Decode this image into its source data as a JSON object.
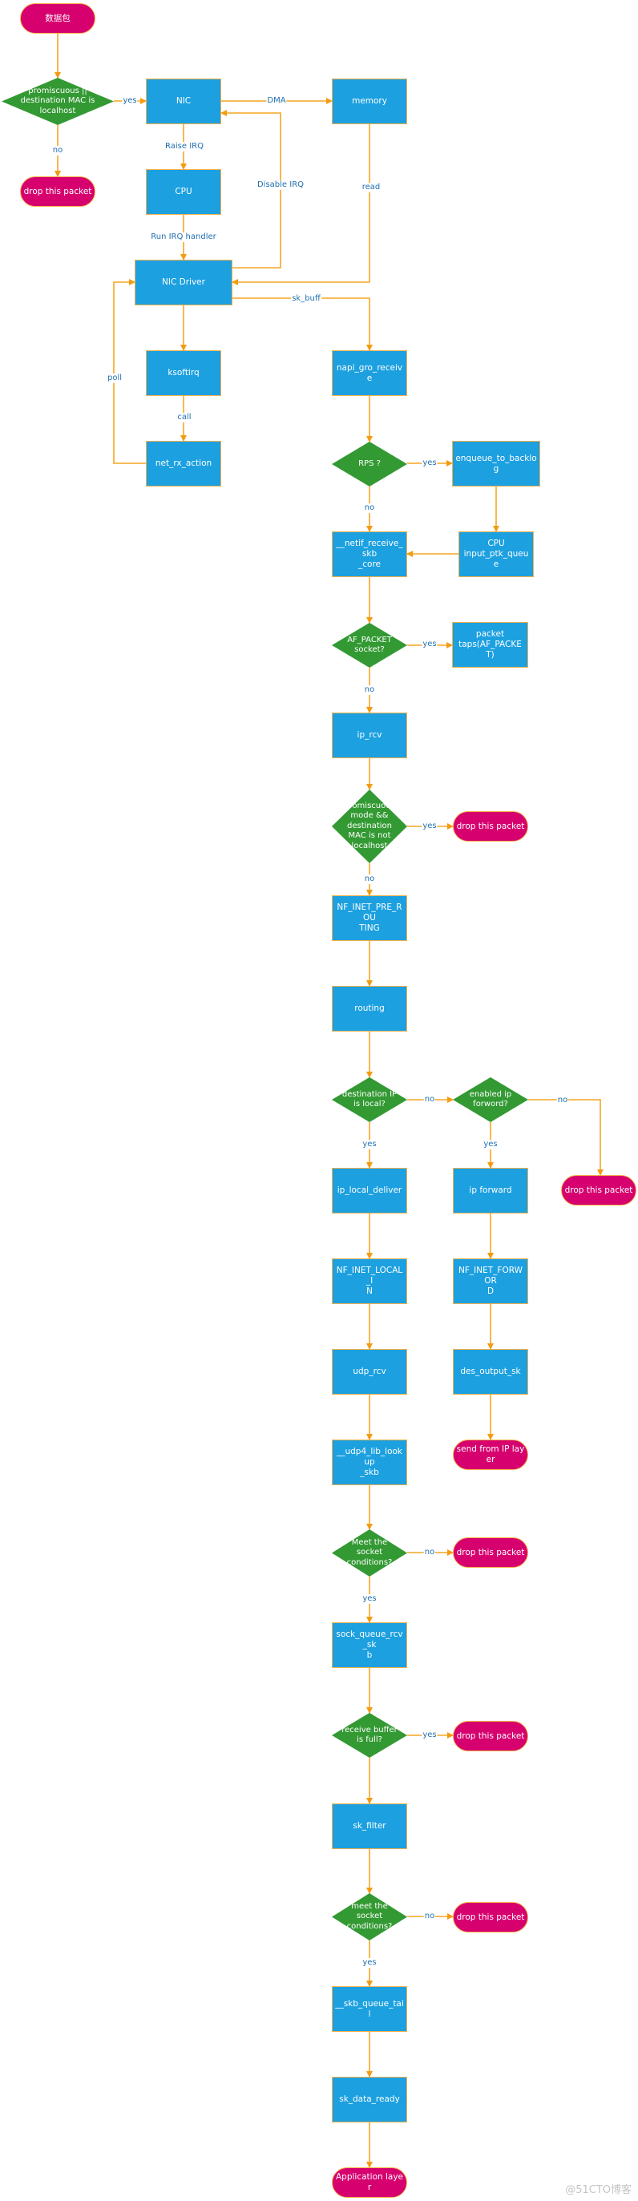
{
  "diagram": {
    "colors": {
      "process": "#1ca0e0",
      "decision": "#339933",
      "terminator": "#d6006f",
      "edge": "#f39c12",
      "edge_label": "#1f6fb0"
    },
    "nodes": {
      "start": "数据包",
      "promisc_check": "promiscuous ||\ndestination MAC is\nlocalhost",
      "drop_1": "drop this packet",
      "nic": "NIC",
      "memory": "memory",
      "cpu": "CPU",
      "nic_driver": "NIC Driver",
      "ksoftirq": "ksoftirq",
      "net_rx_action": "net_rx_action",
      "napi_gro_receive": "napi_gro_receive",
      "rps": "RPS ?",
      "enqueue_to_backlog": "enqueue_to_backlog",
      "cpu_input_queue": "CPU\ninput_ptk_queue",
      "netif_receive_skb_core": "__netif_receive_skb\n_core",
      "af_packet": "AF_PACKET\nsocket?",
      "packet_taps": "packet\ntaps(AF_PACKET)",
      "ip_rcv": "ip_rcv",
      "promisc_not_local": "promiscuous\nmode &&\ndestination\nMAC is not\nlocalhost",
      "drop_2": "drop this packet",
      "nf_pre_routing": "NF_INET_PRE_ROU\nTING",
      "routing": "routing",
      "dest_ip_local": "destination IP\nis local?",
      "ip_forward_enabled": "enabled ip\nforword?",
      "drop_3": "drop this packet",
      "ip_local_deliver": "ip_local_deliver",
      "ip_forward": "ip forward",
      "nf_local_in": "NF_INET_LOCAL_I\nN",
      "nf_forward": "NF_INET_FORWOR\nD",
      "udp_rcv": "udp_rcv",
      "dst_output_sk": "des_output_sk",
      "udp4_lib_lookup": "__udp4_lib_lookup\n_skb",
      "send_from_ip": "send from IP layer",
      "meet_socket_1": "Meet the\nsocket\nconditions?",
      "drop_4": "drop this packet",
      "sock_queue_rcv_skb": "sock_queue_rcv_sk\nb",
      "rcv_buffer_full": "receive buffer\nis full?",
      "drop_5": "drop this packet",
      "sk_filter": "sk_filter",
      "meet_socket_2": "meet the\nsocket\nconditions?",
      "drop_6": "drop this packet",
      "skb_queue_tail": "__skb_queue_tail",
      "sk_data_ready": "sk_data_ready",
      "app_layer": "Application layer"
    },
    "edge_labels": {
      "yes_nic": "yes",
      "no_drop1": "no",
      "dma": "DMA",
      "raise_irq": "Raise IRQ",
      "disable_irq": "Disable IRQ",
      "read": "read",
      "run_irq_handler": "Run IRQ handler",
      "sk_buff": "sk_buff",
      "poll": "poll",
      "call": "call",
      "rps_yes": "yes",
      "rps_no": "no",
      "af_yes": "yes",
      "af_no": "no",
      "promisc_yes": "yes",
      "promisc_no": "no",
      "dest_no": "no",
      "dest_yes": "yes",
      "fwd_yes": "yes",
      "fwd_no": "no",
      "meet1_no": "no",
      "meet1_yes": "yes",
      "buf_yes": "yes",
      "meet2_no": "no",
      "meet2_yes": "yes"
    },
    "watermark": "@51CTO博客"
  }
}
